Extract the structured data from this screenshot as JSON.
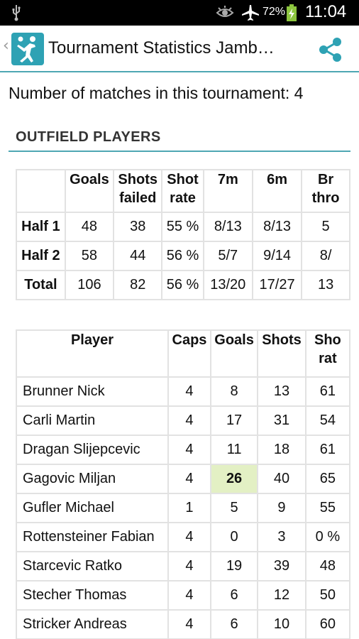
{
  "status": {
    "battery": "72%",
    "time": "11:04",
    "battery_color": "#8dc63f"
  },
  "actionbar": {
    "title": "Tournament Statistics Jamb…",
    "accent": "#4ea7b3",
    "icon_bg": "#2ea2b4"
  },
  "summary": {
    "matches_text": "Number of matches in this tournament: 4"
  },
  "section": {
    "title": "OUTFIELD PLAYERS"
  },
  "halves": {
    "headers": [
      "",
      "Goals",
      "Shots failed",
      "Shot rate",
      "7m",
      "6m",
      "Br thro"
    ],
    "rows": [
      {
        "label": "Half 1",
        "cells": [
          "48",
          "38",
          "55 %",
          "8/13",
          "8/13",
          "5"
        ]
      },
      {
        "label": "Half 2",
        "cells": [
          "58",
          "44",
          "56 %",
          "5/7",
          "9/14",
          "8/"
        ]
      },
      {
        "label": "Total",
        "cells": [
          "106",
          "82",
          "56 %",
          "13/20",
          "17/27",
          "13"
        ]
      }
    ]
  },
  "players": {
    "headers": [
      "Player",
      "Caps",
      "Goals",
      "Shots",
      "Sho rat"
    ],
    "rows": [
      {
        "name": "Brunner Nick",
        "caps": "4",
        "goals": "8",
        "shots": "13",
        "rate": "61"
      },
      {
        "name": "Carli Martin",
        "caps": "4",
        "goals": "17",
        "shots": "31",
        "rate": "54"
      },
      {
        "name": "Dragan Slijepcevic",
        "caps": "4",
        "goals": "11",
        "shots": "18",
        "rate": "61"
      },
      {
        "name": "Gagovic Miljan",
        "caps": "4",
        "goals": "26",
        "shots": "40",
        "rate": "65"
      },
      {
        "name": "Gufler Michael",
        "caps": "1",
        "goals": "5",
        "shots": "9",
        "rate": "55"
      },
      {
        "name": "Rottensteiner Fabian",
        "caps": "4",
        "goals": "0",
        "shots": "3",
        "rate": "0 %"
      },
      {
        "name": "Starcevic Ratko",
        "caps": "4",
        "goals": "19",
        "shots": "39",
        "rate": "48"
      },
      {
        "name": "Stecher Thomas",
        "caps": "4",
        "goals": "6",
        "shots": "12",
        "rate": "50"
      },
      {
        "name": "Stricker Andreas",
        "caps": "4",
        "goals": "6",
        "shots": "10",
        "rate": "60"
      }
    ],
    "highlight_color": "#e3f0c4"
  }
}
